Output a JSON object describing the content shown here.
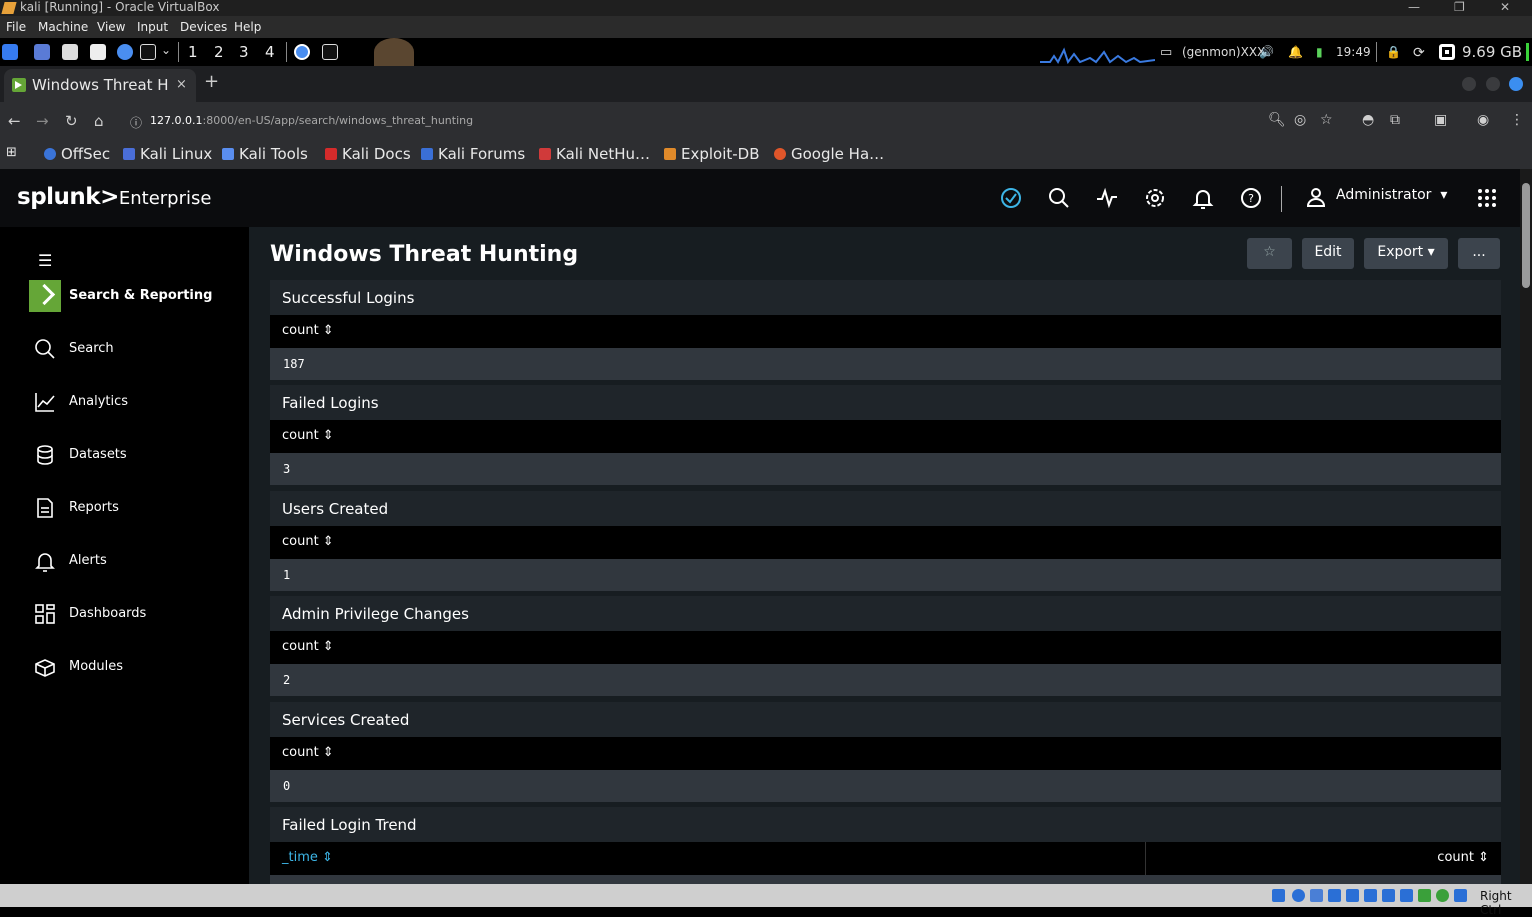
{
  "vbox": {
    "window_title": "kali [Running] - Oracle VirtualBox",
    "menu": [
      "File",
      "Machine",
      "View",
      "Input",
      "Devices",
      "Help"
    ],
    "host_key": "Right Ctrl"
  },
  "kali_panel": {
    "workspaces": [
      "1",
      "2",
      "3",
      "4"
    ],
    "genmon": "(genmon)XXX",
    "time": "19:49",
    "memory": "9.69 GB"
  },
  "browser": {
    "tab_title": "Windows Threat Hunting",
    "tab_close": "×",
    "new_tab": "+",
    "url_host": "127.0.0.1",
    "url_path": ":8000/en-US/app/search/windows_threat_hunting",
    "bookmarks": [
      "OffSec",
      "Kali Linux",
      "Kali Tools",
      "Kali Docs",
      "Kali Forums",
      "Kali NetHu…",
      "Exploit-DB",
      "Google Ha…"
    ]
  },
  "splunk": {
    "logo_main": "splunk>",
    "logo_product": "Enterprise",
    "user": "Administrator",
    "user_caret": "▾",
    "app_name": "Search & Reporting",
    "nav": [
      {
        "label": "Search",
        "icon": "search-icon"
      },
      {
        "label": "Analytics",
        "icon": "analytics-icon"
      },
      {
        "label": "Datasets",
        "icon": "datasets-icon"
      },
      {
        "label": "Reports",
        "icon": "reports-icon"
      },
      {
        "label": "Alerts",
        "icon": "alerts-icon"
      },
      {
        "label": "Dashboards",
        "icon": "dashboards-icon"
      },
      {
        "label": "Modules",
        "icon": "modules-icon"
      }
    ]
  },
  "dashboard": {
    "title": "Windows Threat Hunting",
    "star": "☆",
    "edit": "Edit",
    "export": "Export ▾",
    "more": "...",
    "panels": [
      {
        "title": "Successful Logins",
        "column": "count ⇕",
        "value": "187"
      },
      {
        "title": "Failed Logins",
        "column": "count ⇕",
        "value": "3"
      },
      {
        "title": "Users Created",
        "column": "count ⇕",
        "value": "1"
      },
      {
        "title": "Admin Privilege Changes",
        "column": "count ⇕",
        "value": "2"
      },
      {
        "title": "Services Created",
        "column": "count ⇕",
        "value": "0"
      }
    ],
    "trend": {
      "title": "Failed Login Trend",
      "col_time": "_time ⇕",
      "col_count": "count ⇕"
    }
  }
}
